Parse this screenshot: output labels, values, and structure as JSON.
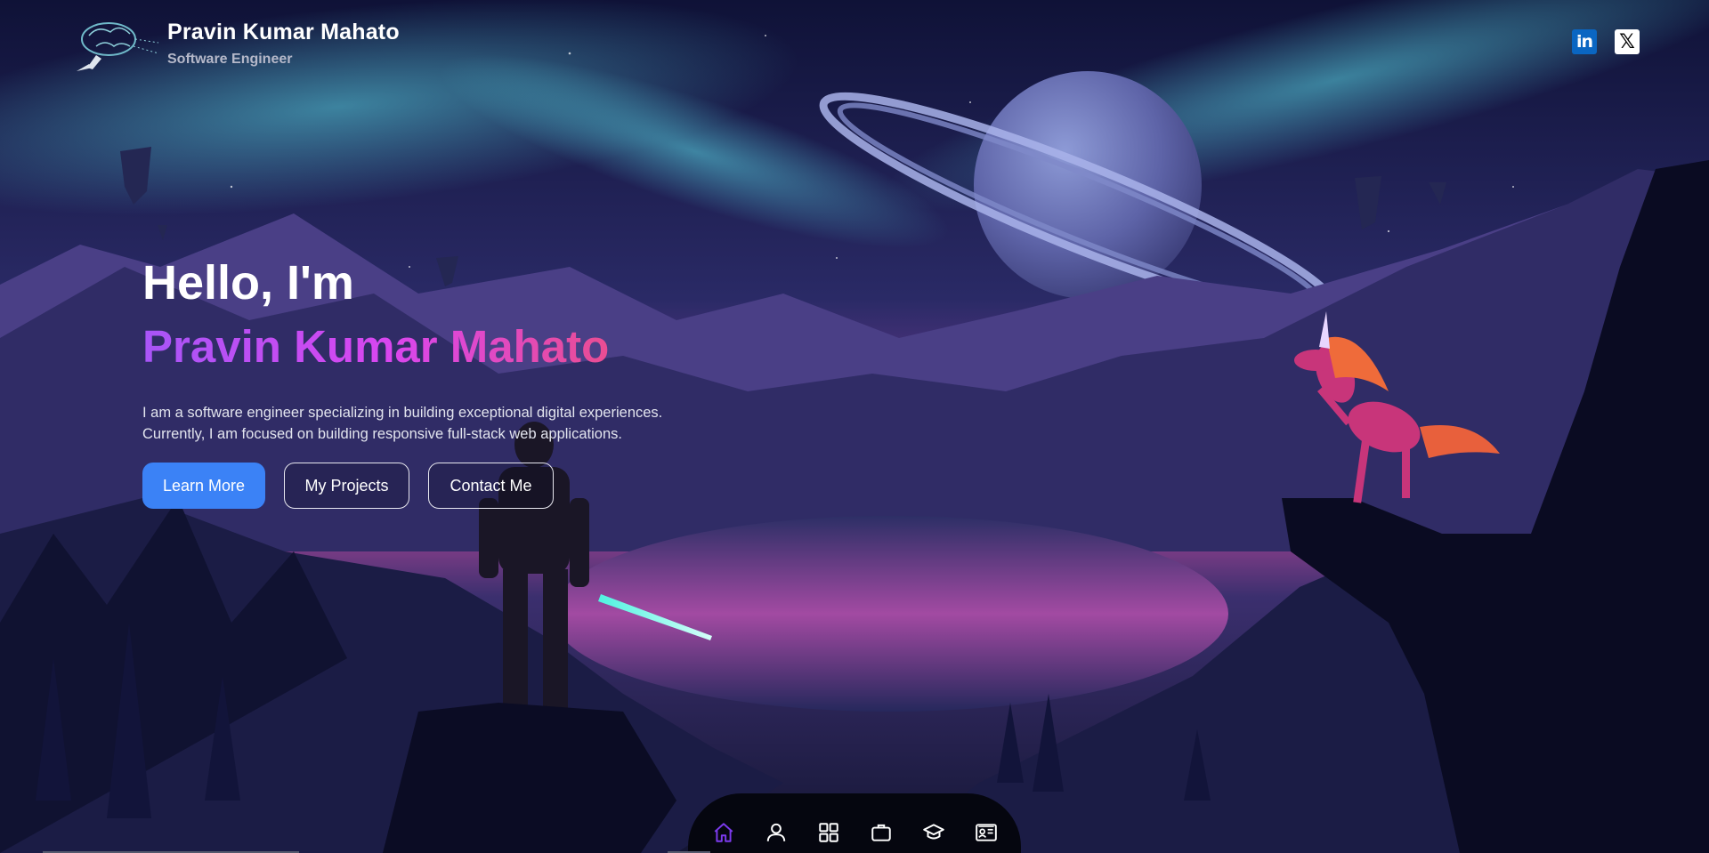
{
  "header": {
    "brand_name": "Pravin Kumar Mahato",
    "brand_role": "Software Engineer",
    "logo_icon": "brain-circuit-logo"
  },
  "socials": [
    {
      "name": "linkedin",
      "icon": "linkedin-icon",
      "glyph": "in",
      "color": "#0a66c2"
    },
    {
      "name": "x",
      "icon": "x-icon",
      "glyph": "𝕏",
      "color": "#ffffff"
    }
  ],
  "hero": {
    "greeting": "Hello, I'm",
    "name": "Pravin Kumar Mahato",
    "intro": "I am a software engineer specializing in building exceptional digital experiences. Currently, I am focused on building responsive full-stack web applications.",
    "buttons": {
      "learn_more": "Learn More",
      "projects": "My Projects",
      "contact": "Contact Me"
    }
  },
  "dock": {
    "items": [
      {
        "name": "home",
        "icon": "home-icon",
        "active": true
      },
      {
        "name": "about",
        "icon": "user-icon",
        "active": false
      },
      {
        "name": "skills",
        "icon": "grid-icon",
        "active": false
      },
      {
        "name": "projects",
        "icon": "briefcase-icon",
        "active": false
      },
      {
        "name": "education",
        "icon": "graduation-cap-icon",
        "active": false
      },
      {
        "name": "contact",
        "icon": "contact-card-icon",
        "active": false
      }
    ]
  },
  "colors": {
    "accent_blue": "#3b82f6",
    "gradient_start": "#a855f7",
    "gradient_end": "#f0506e",
    "dock_bg": "#05060f",
    "active_icon": "#7c3aed"
  }
}
